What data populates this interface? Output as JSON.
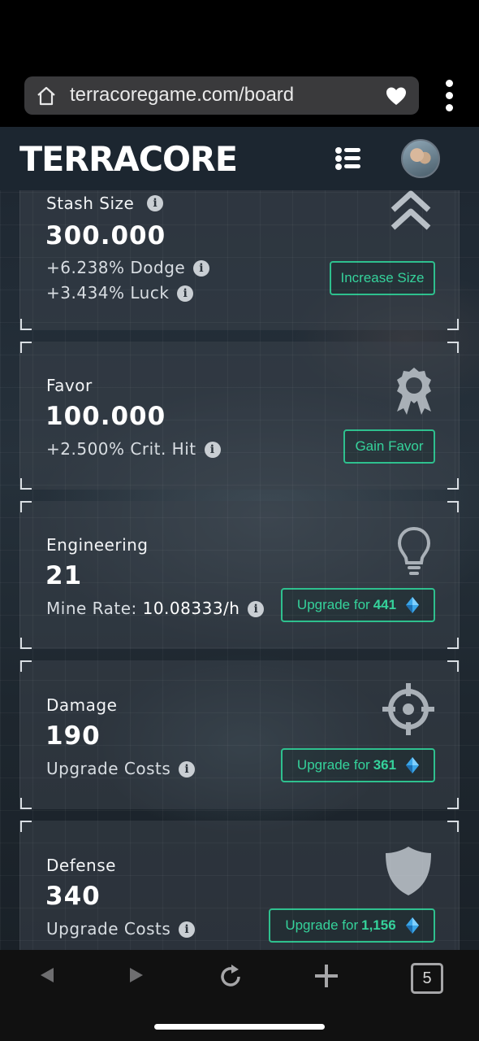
{
  "browser": {
    "url": "terracoregame.com/board",
    "tab_count": "5"
  },
  "app": {
    "brand": "TERRACORE"
  },
  "cards": [
    {
      "label": "Stash Size",
      "value": "300.000",
      "lines": [
        "+6.238% Dodge",
        "+3.434% Luck"
      ],
      "button": "Increase Size",
      "icon": "double-chevron-up-icon"
    },
    {
      "label": "Favor",
      "value": "100.000",
      "lines": [
        "+2.500% Crit. Hit"
      ],
      "button": "Gain Favor",
      "icon": "award-badge-icon"
    },
    {
      "label": "Engineering",
      "value": "21",
      "line_prefix": "Mine Rate:",
      "line_value": "10.08333/h",
      "button_prefix": "Upgrade for",
      "button_amount": "441",
      "icon": "lightbulb-icon"
    },
    {
      "label": "Damage",
      "value": "190",
      "lines": [
        "Upgrade Costs"
      ],
      "button_prefix": "Upgrade for",
      "button_amount": "361",
      "icon": "crosshair-icon"
    },
    {
      "label": "Defense",
      "value": "340",
      "lines": [
        "Upgrade Costs"
      ],
      "button_prefix": "Upgrade for",
      "button_amount": "1,156",
      "icon": "shield-icon"
    }
  ],
  "colors": {
    "accent": "#2ec08e",
    "background": "#1d2630"
  }
}
